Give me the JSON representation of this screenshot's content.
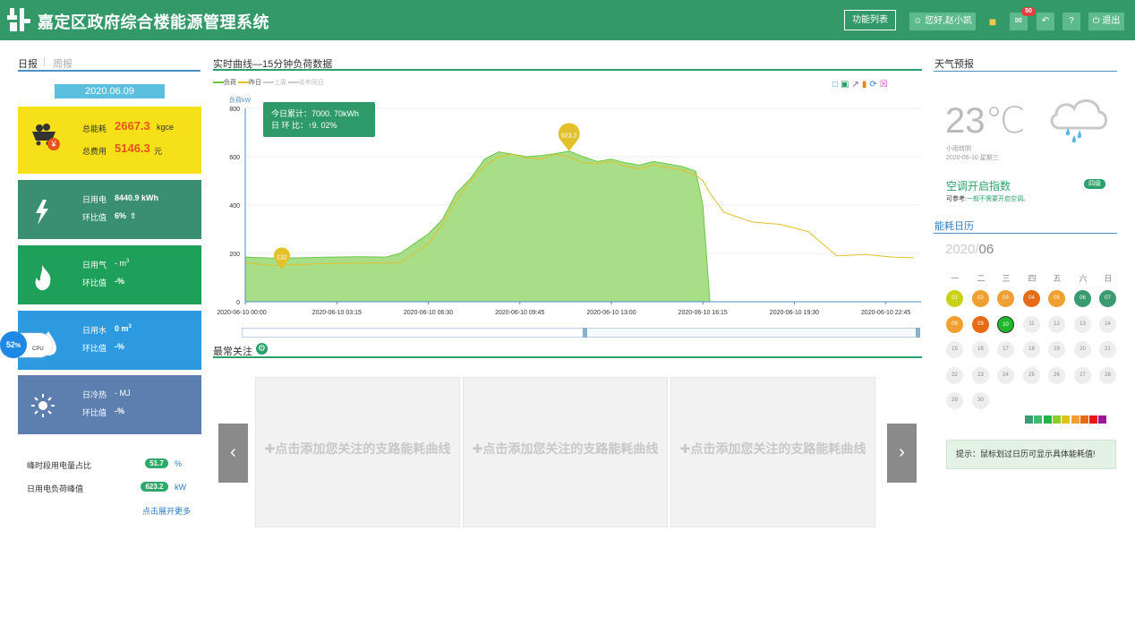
{
  "header": {
    "title": "嘉定区政府综合楼能源管理系统",
    "func_list": "功能列表",
    "greeting": "您好,赵小凯",
    "mail_count": "50",
    "logout": "退出",
    "help": "?"
  },
  "left": {
    "tab_daily": "日报",
    "tab_weekly": "周报",
    "date": "2020.06.09",
    "total": {
      "energy_label": "总能耗",
      "energy_value": "2667.3",
      "energy_unit": "kgce",
      "cost_label": "总费用",
      "cost_value": "5146.3",
      "cost_unit": "元"
    },
    "elec": {
      "label": "日用电",
      "value": "8440.9 kWh",
      "ratio_label": "环比值",
      "ratio_value": "6%"
    },
    "gas": {
      "label": "日用气",
      "value": "- m",
      "sup": "3",
      "ratio_label": "环比值",
      "ratio_value": "-%"
    },
    "water": {
      "label": "日用水",
      "value": "0 m",
      "sup": "3",
      "ratio_label": "环比值",
      "ratio_value": "-%"
    },
    "heat": {
      "label": "日冷热",
      "value": "- MJ",
      "ratio_label": "环比值",
      "ratio_value": "-%"
    },
    "cpu": {
      "value": "52",
      "unit": "%",
      "label": "CPU"
    },
    "stats": [
      {
        "label": "峰时段用电量占比",
        "value": "51.7",
        "unit": "%"
      },
      {
        "label": "日用电负荷峰值",
        "value": "623.2",
        "unit": "kW"
      }
    ],
    "more": "点击展开更多"
  },
  "chart": {
    "title": "实时曲线—15分钟负荷数据",
    "legend": [
      "负荷",
      "昨日",
      "上周",
      "去年同日"
    ],
    "ylabel": "负荷kW",
    "tooltip_line1": "今日累计：7000. 70kWh",
    "tooltip_line2": "日 环 比：↑9. 02%",
    "pin_max": "623.2",
    "pin_min": "132"
  },
  "chart_data": {
    "type": "area",
    "title": "实时曲线—15分钟负荷数据",
    "ylabel": "负荷kW",
    "ylim": [
      0,
      800
    ],
    "yticks": [
      0,
      200,
      400,
      600,
      800
    ],
    "xticks": [
      "2020-06-10 00:00",
      "2020-06-10 03:15",
      "2020-06-10 06:30",
      "2020-06-10 09:45",
      "2020-06-10 13:00",
      "2020-06-10 16:15",
      "2020-06-10 19:30",
      "2020-06-10 22:45"
    ],
    "x_hours": [
      0,
      1,
      2,
      3,
      4,
      5,
      5.5,
      6,
      6.5,
      7,
      7.5,
      8,
      8.5,
      9,
      9.5,
      10,
      10.5,
      11,
      11.5,
      12,
      12.5,
      13,
      13.5,
      14,
      14.5,
      15,
      15.5,
      16,
      16.25,
      16.5,
      17,
      18,
      19,
      20,
      21,
      22,
      23,
      23.75
    ],
    "series": [
      {
        "name": "负荷",
        "values": [
          185,
          180,
          182,
          185,
          186,
          185,
          200,
          240,
          280,
          340,
          450,
          510,
          590,
          620,
          610,
          600,
          605,
          612,
          623,
          600,
          580,
          590,
          575,
          565,
          580,
          570,
          560,
          540,
          400,
          0,
          null,
          null,
          null,
          null,
          null,
          null,
          null,
          null
        ]
      },
      {
        "name": "昨日",
        "values": [
          160,
          150,
          155,
          158,
          160,
          160,
          162,
          200,
          240,
          320,
          420,
          500,
          560,
          600,
          610,
          595,
          590,
          610,
          600,
          575,
          570,
          580,
          560,
          550,
          565,
          555,
          545,
          525,
          500,
          450,
          370,
          330,
          320,
          290,
          190,
          195,
          185,
          182
        ]
      }
    ],
    "markers": [
      {
        "label": "623.2",
        "hour": 11.5,
        "value": 623.2
      },
      {
        "label": "132",
        "hour": 1.3,
        "value": 132
      }
    ]
  },
  "favorites": {
    "title": "最常关注",
    "items": [
      "点击添加您关注的支路能耗曲线",
      "点击添加您关注的支路能耗曲线",
      "点击添加您关注的支路能耗曲线"
    ]
  },
  "weather": {
    "title": "天气预报",
    "temp": "23℃",
    "cond": "小雨转阴",
    "date": "2020-06-10 星期三",
    "ac_title": "空调开启指数",
    "ac_level": "四级",
    "ac_desc_label": "可参考:",
    "ac_desc": "一般不需要开启空调。"
  },
  "calendar": {
    "title": "能耗日历",
    "year": "2020/",
    "month": "06",
    "weekdays": [
      "一",
      "二",
      "三",
      "四",
      "五",
      "六",
      "日"
    ],
    "days": [
      "01",
      "02",
      "03",
      "04",
      "05",
      "06",
      "07",
      "08",
      "09",
      "10",
      "11",
      "12",
      "13",
      "14",
      "15",
      "16",
      "17",
      "18",
      "19",
      "20",
      "21",
      "22",
      "23",
      "24",
      "25",
      "26",
      "27",
      "28",
      "29",
      "30"
    ],
    "day_colors": [
      "#c9d21a",
      "#f0a030",
      "#f0a030",
      "#e86a14",
      "#f0a030",
      "#3a9a70",
      "#3a9a70",
      "#f0a030",
      "#e86a14",
      "#1fb82a"
    ],
    "legend_colors": [
      "#3a9a70",
      "#3fba6e",
      "#22b34a",
      "#8fcc2a",
      "#e0c21a",
      "#f0a030",
      "#e86a14",
      "#e8141a",
      "#a0159a"
    ],
    "tip": "提示：鼠标划过日历可显示具体能耗值!"
  }
}
